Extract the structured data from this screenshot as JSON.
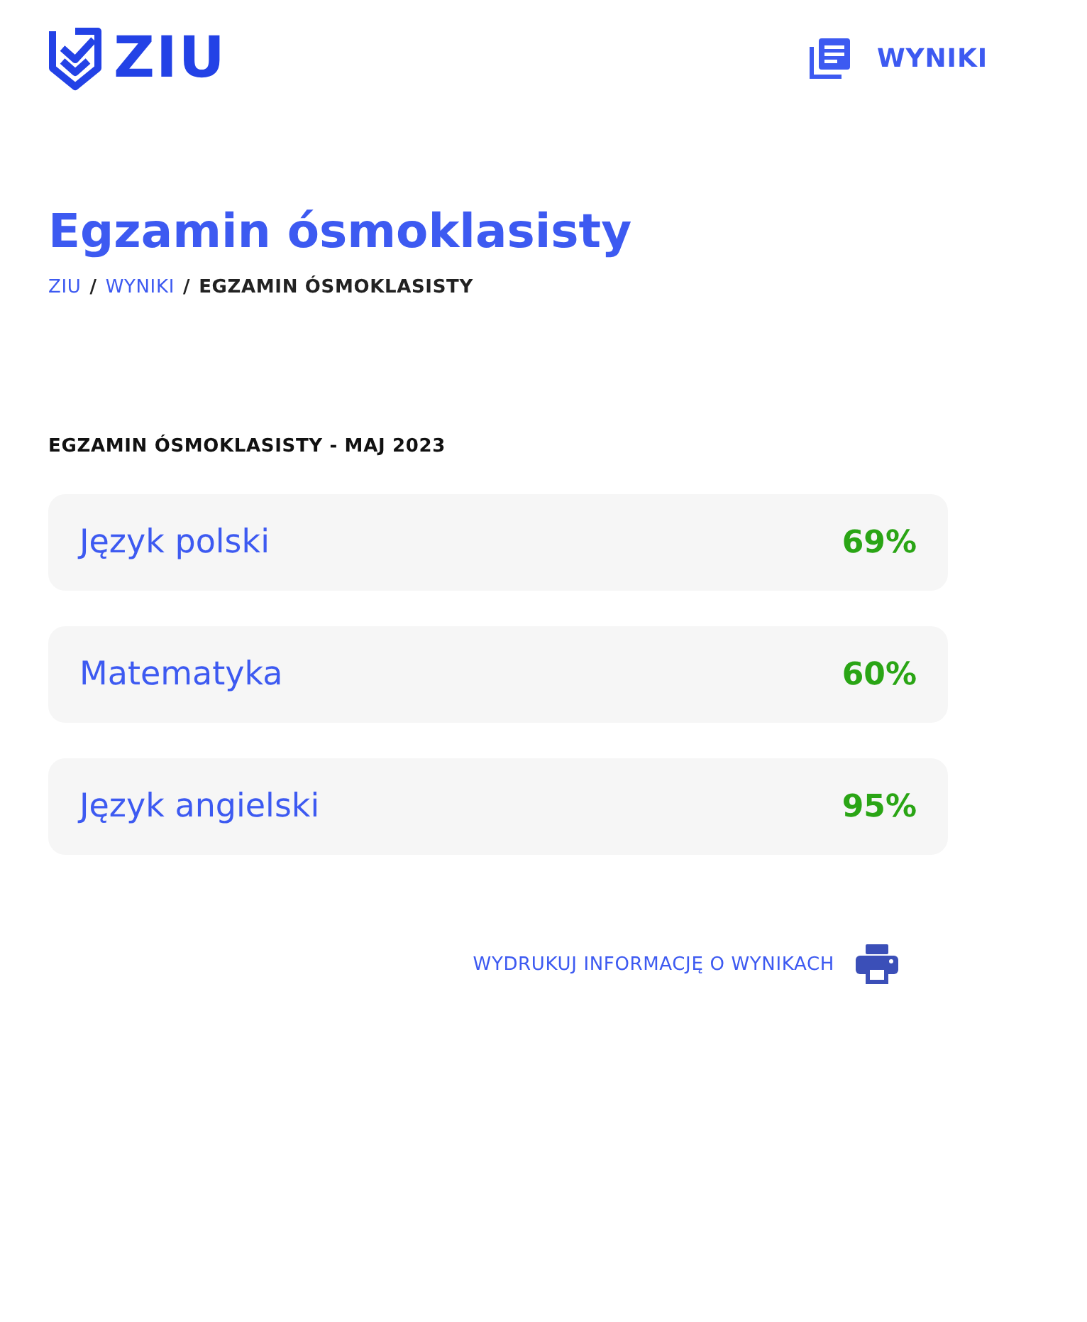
{
  "header": {
    "logo_text": "ZIU",
    "nav_link": "WYNIKI"
  },
  "page_title": "Egzamin ósmoklasisty",
  "breadcrumb": [
    {
      "label": "ZIU",
      "link": true
    },
    {
      "separator": "/",
      "label": "WYNIKI",
      "link": true
    },
    {
      "separator": "/",
      "label": "EGZAMIN ÓSMOKLASISTY",
      "link": false
    }
  ],
  "section_title": "EGZAMIN ÓSMOKLASISTY - MAJ 2023",
  "results": [
    {
      "subject": "Język polski",
      "score": "69%"
    },
    {
      "subject": "Matematyka",
      "score": "60%"
    },
    {
      "subject": "Język angielski",
      "score": "95%"
    }
  ],
  "print_link": "WYDRUKUJ INFORMACJĘ O WYNIKACH"
}
